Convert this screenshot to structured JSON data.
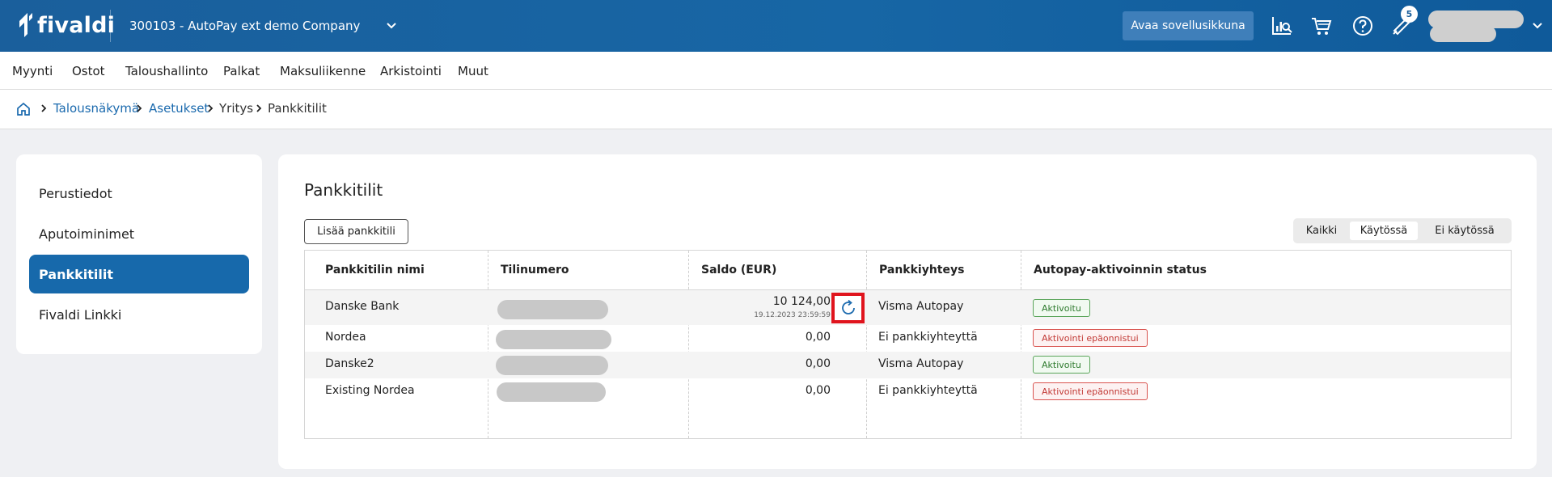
{
  "header": {
    "logo_text": "fivaldi",
    "company": "300103 - AutoPay ext demo Company",
    "open_app_label": "Avaa sovellusikkuna",
    "notification_count": "5",
    "bg_color": "#1766a5"
  },
  "main_nav": {
    "items": [
      "Myynti",
      "Ostot",
      "Taloushallinto",
      "Palkat",
      "Maksuliikenne",
      "Arkistointi",
      "Muut"
    ]
  },
  "breadcrumb": {
    "items": [
      "Talousnäkymä",
      "Asetukset",
      "Yritys",
      "Pankkitilit"
    ]
  },
  "sidebar": {
    "items": [
      "Perustiedot",
      "Aputoiminimet",
      "Pankkitilit",
      "Fivaldi Linkki"
    ],
    "active": "Pankkitilit",
    "active_color": "#1769ab"
  },
  "main": {
    "title": "Pankkitilit",
    "add_button": "Lisää pankkitili",
    "filters": [
      "Kaikki",
      "Käytössä",
      "Ei käytössä"
    ],
    "active_filter": "Käytössä"
  },
  "table": {
    "columns": [
      "Pankkitilin nimi",
      "Tilinumero",
      "Saldo (EUR)",
      "Pankkiyhteys",
      "Autopay-aktivoinnin status"
    ],
    "rows": [
      {
        "name": "Danske Bank",
        "saldo": "10 124,00",
        "saldo_date": "19.12.2023 23:59:59",
        "connection": "Visma Autopay",
        "status": "Aktivoitu",
        "status_type": "ok"
      },
      {
        "name": "Nordea",
        "saldo": "0,00",
        "saldo_date": "",
        "connection": "Ei pankkiyhteyttä",
        "status": "Aktivointi epäonnistui",
        "status_type": "fail"
      },
      {
        "name": "Danske2",
        "saldo": "0,00",
        "saldo_date": "",
        "connection": "Visma Autopay",
        "status": "Aktivoitu",
        "status_type": "ok"
      },
      {
        "name": "Existing Nordea",
        "saldo": "0,00",
        "saldo_date": "",
        "connection": "Ei pankkiyhteyttä",
        "status": "Aktivointi epäonnistui",
        "status_type": "fail"
      }
    ]
  }
}
